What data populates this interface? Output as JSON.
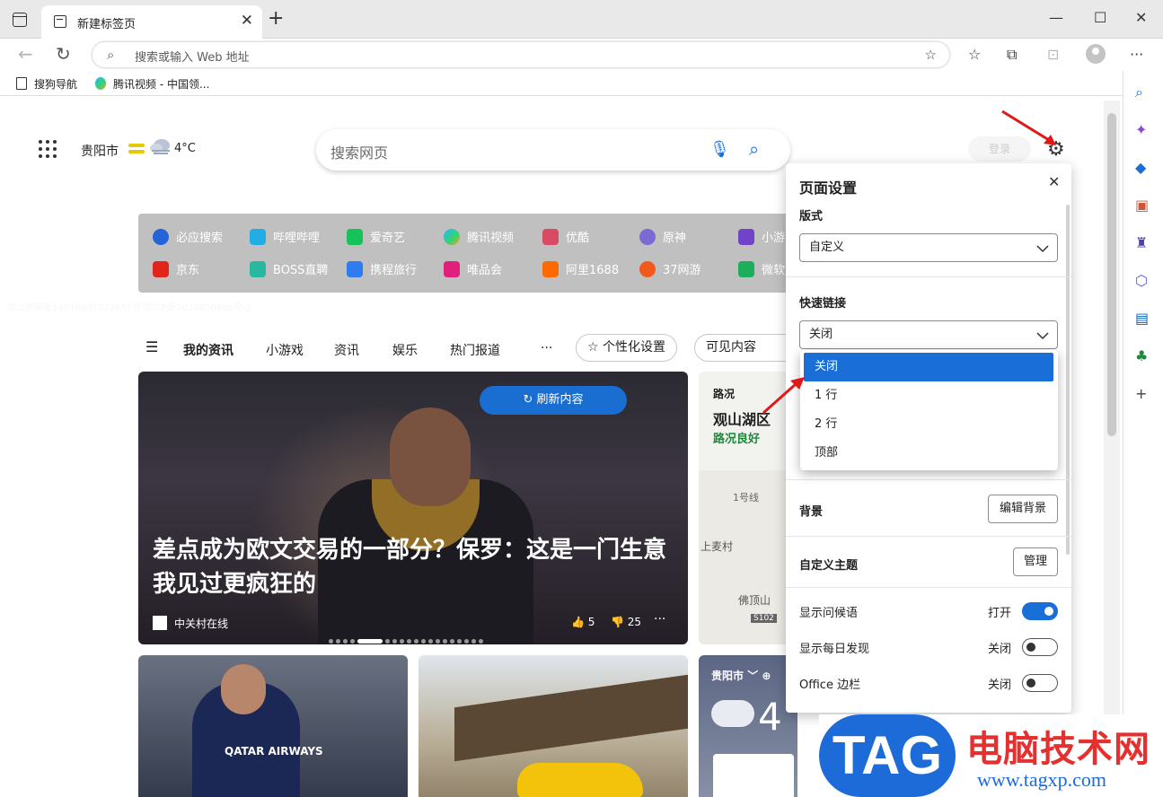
{
  "tab": {
    "title": "新建标签页"
  },
  "address": {
    "placeholder": "搜索或输入 Web 地址"
  },
  "bookmarks": [
    {
      "label": "搜狗导航"
    },
    {
      "label": "腾讯视频 - 中国领..."
    }
  ],
  "header": {
    "city": "贵阳市",
    "temp": "4°C",
    "login": "登录"
  },
  "search": {
    "placeholder": "搜索网页"
  },
  "quicklinks": [
    {
      "label": "必应搜索",
      "color": "#2563d9"
    },
    {
      "label": "哔哩哔哩",
      "color": "#23ade5"
    },
    {
      "label": "爱奇艺",
      "color": "#16c35a"
    },
    {
      "label": "腾讯视频",
      "color": "#ff9f1a"
    },
    {
      "label": "优酷",
      "color": "#d94a64"
    },
    {
      "label": "原神",
      "color": "#7a6ad3"
    },
    {
      "label": "小游",
      "color": "#7143c8"
    },
    {
      "label": "京东",
      "color": "#e1251b"
    },
    {
      "label": "BOSS直聘",
      "color": "#28b8a0"
    },
    {
      "label": "携程旅行",
      "color": "#2f7cf0"
    },
    {
      "label": "唯品会",
      "color": "#e0207a"
    },
    {
      "label": "阿里1688",
      "color": "#ff6a00"
    },
    {
      "label": "37网游",
      "color": "#f05a1a"
    },
    {
      "label": "微软",
      "color": "#1dae5c"
    }
  ],
  "faded_text": "京公网安备11010802022657号 京ICP备2020020808号-1",
  "feed_tabs": [
    "我的资讯",
    "小游戏",
    "资讯",
    "娱乐",
    "热门报道",
    "···"
  ],
  "feed_buttons": {
    "personalize": "个性化设置",
    "visible": "可见内容"
  },
  "hero": {
    "refresh": "刷新内容",
    "headline": "差点成为欧文交易的一部分？保罗：这是一门生意 我见过更疯狂的",
    "source": "中关村在线",
    "likes": "5",
    "dislikes": "25",
    "more": "···"
  },
  "traffic": {
    "label": "路况",
    "place": "观山湖区",
    "status": "路况良好",
    "map1": "1号线",
    "map2": "上麦村",
    "map3": "佛顶山",
    "road": "S102"
  },
  "card1": {
    "jersey": "QATAR AIRWAYS"
  },
  "weather_card": {
    "city": "贵阳市",
    "temp": "4"
  },
  "settings": {
    "title": "页面设置",
    "layout_label": "版式",
    "layout_value": "自定义",
    "quicklinks_label": "快速链接",
    "quicklinks_value": "关闭",
    "options": [
      "关闭",
      "1 行",
      "2 行",
      "顶部"
    ],
    "background_label": "背景",
    "background_btn": "编辑背景",
    "theme_label": "自定义主题",
    "theme_btn": "管理",
    "toggles": [
      {
        "label": "显示问候语",
        "state": "打开",
        "on": true
      },
      {
        "label": "显示每日发现",
        "state": "关闭",
        "on": false
      },
      {
        "label": "Office 边栏",
        "state": "关闭",
        "on": false
      }
    ]
  },
  "watermark": {
    "tag": "TAG",
    "name": "电脑技术网",
    "url": "www.tagxp.com"
  }
}
